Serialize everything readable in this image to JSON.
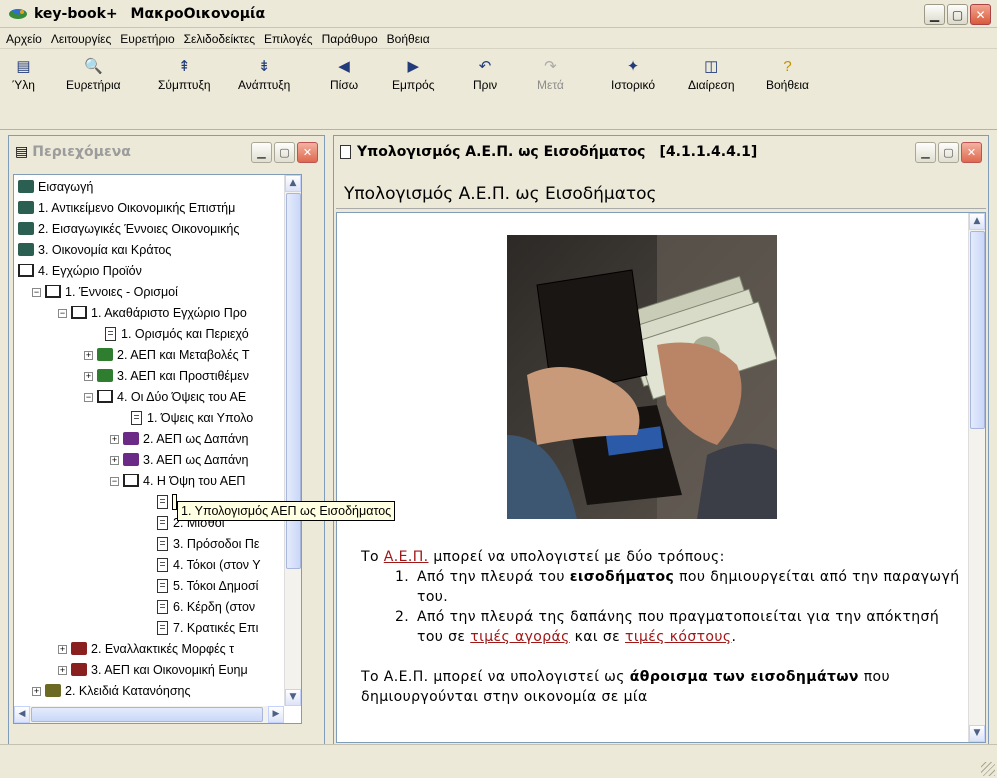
{
  "window": {
    "title": "key-book+  ΜακροΟικονομία"
  },
  "menu": [
    "Αρχείο",
    "Λειτουργίες",
    "Ευρετήριο",
    "Σελιδοδείκτες",
    "Επιλογές",
    "Παράθυρο",
    "Βοήθεια"
  ],
  "toolbar": {
    "yli": "Ύλη",
    "evretiria": "Ευρετήρια",
    "symptyxi": "Σύμπτυξη",
    "anaptyxi": "Ανάπτυξη",
    "piso": "Πίσω",
    "empros": "Εμπρός",
    "prin": "Πριν",
    "meta": "Μετά",
    "istoriko": "Ιστορικό",
    "diairesi": "Διαίρεση",
    "voitheia": "Βοήθεια"
  },
  "contents_pane": {
    "title": "Περιεχόμενα",
    "tree": [
      "Εισαγωγή",
      "1. Αντικείμενο Οικονομικής Επιστήμ",
      "2. Εισαγωγικές Έννοιες Οικονομικής",
      "3. Οικονομία και Κράτος",
      "4. Εγχώριο Προϊόν",
      "1. Έννοιες - Ορισμοί",
      "1. Ακαθάριστο Εγχώριο Προ",
      "1. Ορισμός και Περιεχό",
      "2. ΑΕΠ και Μεταβολές Τ",
      "3. ΑΕΠ και Προστιθέμεν",
      "4. Οι Δύο Όψεις του ΑΕ",
      "1. Όψεις και Υπολο",
      "2. ΑΕΠ ως Δαπάνη ",
      "3. ΑΕΠ ως Δαπάνη ",
      "4. Η Όψη του ΑΕΠ ",
      "1. Υπολογισμός ΑΕΠ ως Εισοδήματος",
      "2. Μισθοί",
      "3. Πρόσοδοι Πε",
      "4. Τόκοι (στον Υ",
      "5. Τόκοι Δημοσί",
      "6. Κέρδη (στον",
      "7. Κρατικές Επι",
      "2. Εναλλακτικές Μορφές τ",
      "3. ΑΕΠ και Οικονομική Ευημ",
      "2. Κλειδιά Κατανόησης"
    ]
  },
  "content_pane": {
    "title": "Υπολογισμός Α.Ε.Π. ως Εισοδήματος",
    "code": "[4.1.1.4.4.1]",
    "heading": "Υπολογισμός Α.Ε.Π. ως Εισοδήματος",
    "p1_pre": "Το ",
    "p1_link": "Α.Ε.Π.",
    "p1_post": " μπορεί να υπολογιστεί με δύο τρόπους:",
    "item1_num": "1.",
    "item1_pre": "Από την πλευρά του ",
    "item1_bold": "εισοδήματος",
    "item1_post": " που δημιουργείται από την παραγωγή του.",
    "item2_num": "2.",
    "item2_pre": "Από την πλευρά της δαπάνης που πραγματοποιείται για την απόκτησή του σε ",
    "item2_link1": "τιμές αγοράς",
    "item2_mid": " και σε ",
    "item2_link2": "τιμές κόστους",
    "item2_post": ".",
    "p2_pre": "Το Α.Ε.Π. μπορεί να υπολογιστεί ως ",
    "p2_bold": "άθροισμα των εισοδημάτων",
    "p2_post": " που δημιουργούνται στην οικονομία σε μία"
  }
}
